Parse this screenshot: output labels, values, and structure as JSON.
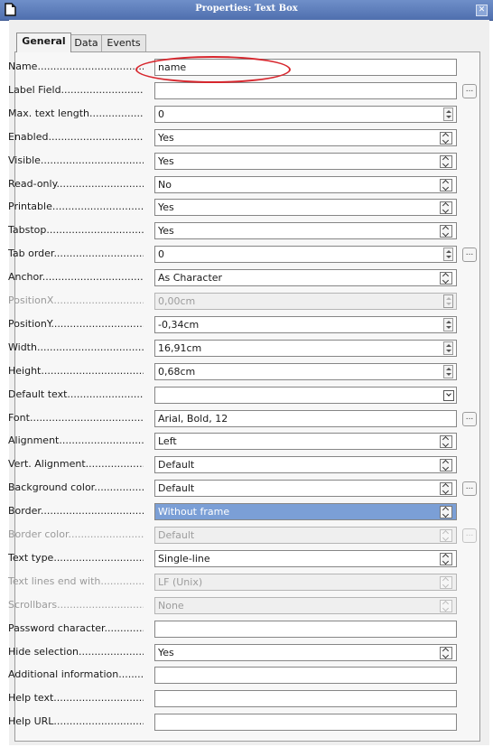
{
  "window": {
    "title": "Properties: Text Box"
  },
  "tabs": [
    "General",
    "Data",
    "Events"
  ],
  "rows": [
    {
      "label": "Name",
      "value": "name"
    },
    {
      "label": "Label Field",
      "value": ""
    },
    {
      "label": "Max. text length",
      "value": "0"
    },
    {
      "label": "Enabled",
      "value": "Yes"
    },
    {
      "label": "Visible",
      "value": "Yes"
    },
    {
      "label": "Read-only",
      "value": "No"
    },
    {
      "label": "Printable",
      "value": "Yes"
    },
    {
      "label": "Tabstop",
      "value": "Yes"
    },
    {
      "label": "Tab order",
      "value": "0"
    },
    {
      "label": "Anchor",
      "value": "As Character"
    },
    {
      "label": "PositionX",
      "value": "0,00cm"
    },
    {
      "label": "PositionY",
      "value": "-0,34cm"
    },
    {
      "label": "Width",
      "value": "16,91cm"
    },
    {
      "label": "Height",
      "value": "0,68cm"
    },
    {
      "label": "Default text",
      "value": ""
    },
    {
      "label": "Font",
      "value": "Arial, Bold, 12"
    },
    {
      "label": "Alignment",
      "value": "Left"
    },
    {
      "label": "Vert. Alignment",
      "value": "Default"
    },
    {
      "label": "Background color",
      "value": "Default"
    },
    {
      "label": "Border",
      "value": "Without frame"
    },
    {
      "label": "Border color",
      "value": "Default"
    },
    {
      "label": "Text type",
      "value": "Single-line"
    },
    {
      "label": "Text lines end with",
      "value": "LF (Unix)"
    },
    {
      "label": "Scrollbars",
      "value": "None"
    },
    {
      "label": "Password character",
      "value": ""
    },
    {
      "label": "Hide selection",
      "value": "Yes"
    },
    {
      "label": "Additional information",
      "value": ""
    },
    {
      "label": "Help text",
      "value": ""
    },
    {
      "label": "Help URL",
      "value": ""
    }
  ],
  "dots_label": "...",
  "colors": {
    "titlebar": "#5678b9",
    "selection": "#7b9fd6",
    "annotation": "#d7262d"
  },
  "icons": {
    "window": "document-icon",
    "close": "close-icon"
  }
}
